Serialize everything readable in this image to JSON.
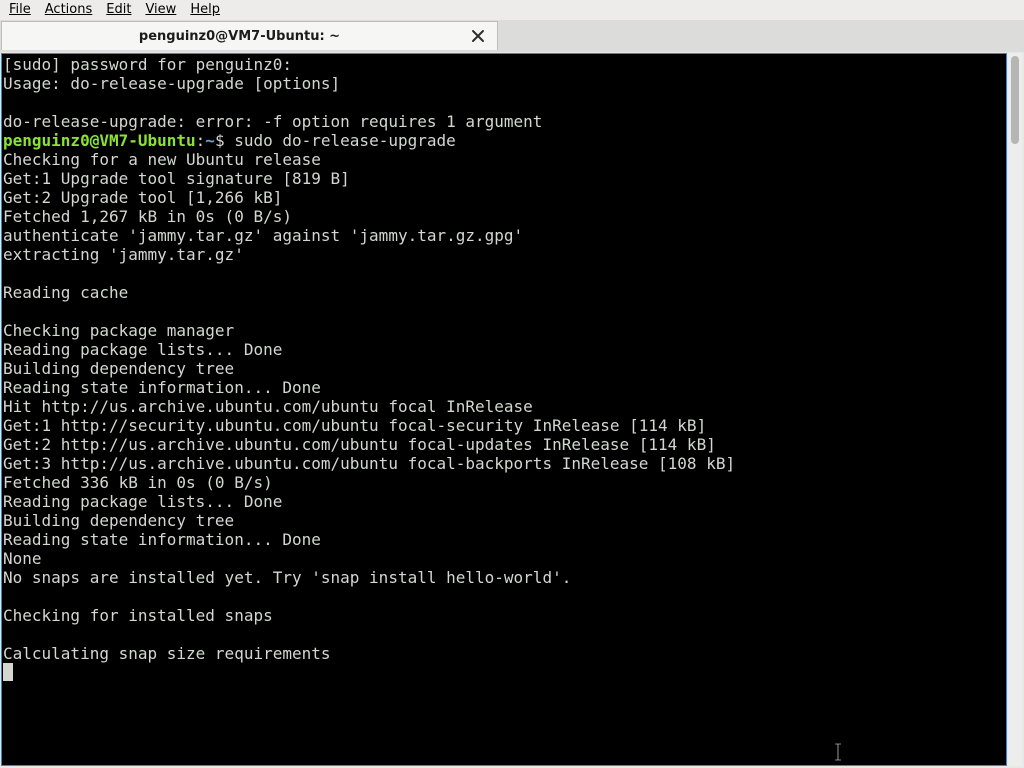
{
  "menubar": {
    "items": [
      {
        "label": "File"
      },
      {
        "label": "Actions"
      },
      {
        "label": "Edit"
      },
      {
        "label": "View"
      },
      {
        "label": "Help"
      }
    ]
  },
  "tab": {
    "title": "penguinz0@VM7-Ubuntu: ~",
    "close_icon": "close-icon"
  },
  "terminal": {
    "lines": [
      {
        "text": "[sudo] password for penguinz0:"
      },
      {
        "text": "Usage: do-release-upgrade [options]"
      },
      {
        "text": ""
      },
      {
        "text": "do-release-upgrade: error: -f option requires 1 argument"
      },
      {
        "prompt_user": "penguinz0@VM7-Ubuntu",
        "prompt_sep": ":",
        "prompt_path": "~",
        "prompt_sym": "$ ",
        "command": "sudo do-release-upgrade"
      },
      {
        "text": "Checking for a new Ubuntu release"
      },
      {
        "text": "Get:1 Upgrade tool signature [819 B]"
      },
      {
        "text": "Get:2 Upgrade tool [1,266 kB]"
      },
      {
        "text": "Fetched 1,267 kB in 0s (0 B/s)"
      },
      {
        "text": "authenticate 'jammy.tar.gz' against 'jammy.tar.gz.gpg'"
      },
      {
        "text": "extracting 'jammy.tar.gz'"
      },
      {
        "text": ""
      },
      {
        "text": "Reading cache"
      },
      {
        "text": ""
      },
      {
        "text": "Checking package manager"
      },
      {
        "text": "Reading package lists... Done"
      },
      {
        "text": "Building dependency tree"
      },
      {
        "text": "Reading state information... Done"
      },
      {
        "text": "Hit http://us.archive.ubuntu.com/ubuntu focal InRelease"
      },
      {
        "text": "Get:1 http://security.ubuntu.com/ubuntu focal-security InRelease [114 kB]"
      },
      {
        "text": "Get:2 http://us.archive.ubuntu.com/ubuntu focal-updates InRelease [114 kB]"
      },
      {
        "text": "Get:3 http://us.archive.ubuntu.com/ubuntu focal-backports InRelease [108 kB]"
      },
      {
        "text": "Fetched 336 kB in 0s (0 B/s)"
      },
      {
        "text": "Reading package lists... Done"
      },
      {
        "text": "Building dependency tree"
      },
      {
        "text": "Reading state information... Done"
      },
      {
        "text": "None"
      },
      {
        "text": "No snaps are installed yet. Try 'snap install hello-world'."
      },
      {
        "text": ""
      },
      {
        "text": "Checking for installed snaps"
      },
      {
        "text": ""
      },
      {
        "text": "Calculating snap size requirements"
      }
    ],
    "colors": {
      "background": "#000000",
      "foreground": "#d3d7cf",
      "prompt_user": "#8ae234",
      "prompt_path": "#729fcf"
    }
  },
  "scrollbar": {
    "position": "top"
  }
}
